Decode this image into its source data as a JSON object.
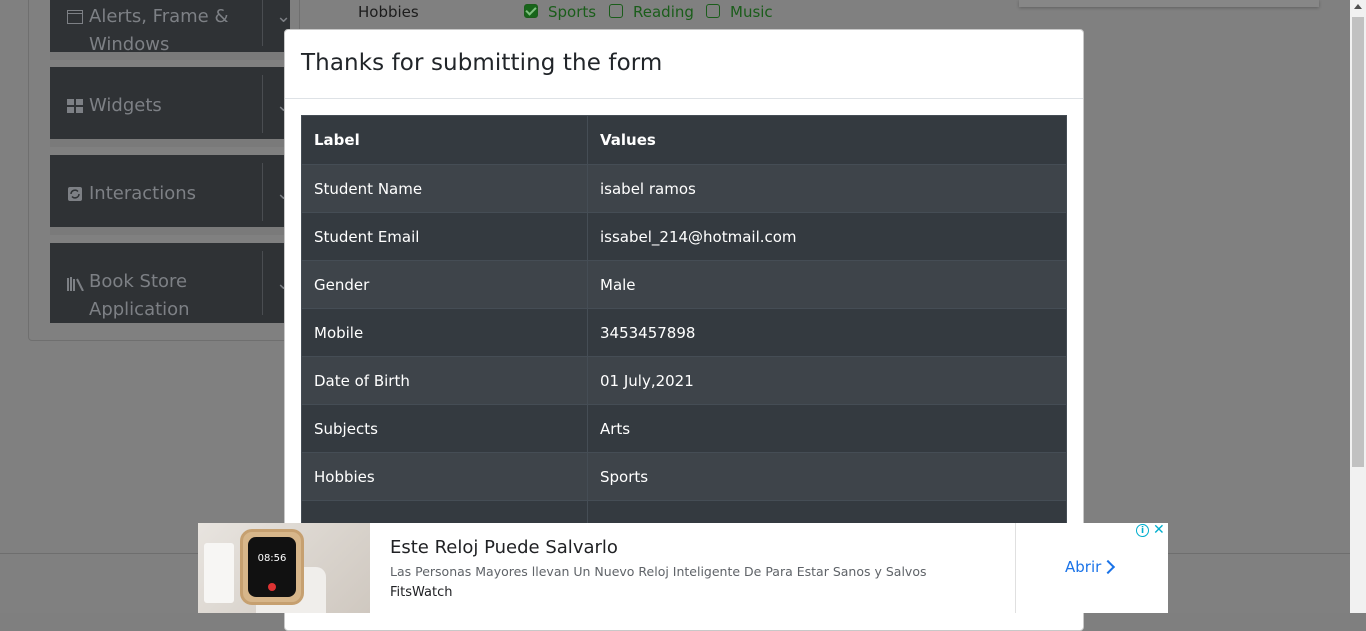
{
  "sidebar": {
    "groups": [
      {
        "label_line1": "Alerts, Frame &",
        "label_line2": "Windows",
        "icon": "window-icon"
      },
      {
        "label_line1": "Widgets",
        "icon": "widgets-icon"
      },
      {
        "label_line1": "Interactions",
        "icon": "interactions-icon"
      },
      {
        "label_line1": "Book Store",
        "label_line2": "Application",
        "icon": "book-icon"
      }
    ]
  },
  "form": {
    "hobbies_label": "Hobbies",
    "hobbies": [
      {
        "label": "Sports",
        "checked": true
      },
      {
        "label": "Reading",
        "checked": false
      },
      {
        "label": "Music",
        "checked": false
      }
    ]
  },
  "modal": {
    "title": "Thanks for submitting the form",
    "table": {
      "headers": [
        "Label",
        "Values"
      ],
      "rows": [
        [
          "Student Name",
          "isabel ramos"
        ],
        [
          "Student Email",
          "issabel_214@hotmail.com"
        ],
        [
          "Gender",
          "Male"
        ],
        [
          "Mobile",
          "3453457898"
        ],
        [
          "Date of Birth",
          "01 July,2021"
        ],
        [
          "Subjects",
          "Arts"
        ],
        [
          "Hobbies",
          "Sports"
        ],
        [
          "",
          ""
        ]
      ]
    }
  },
  "ad": {
    "title": "Este Reloj Puede Salvarlo",
    "description": "Las Personas Mayores llevan Un Nuevo Reloj Inteligente De Para Estar Sanos y Salvos",
    "brand": "FitsWatch",
    "cta": "Abrir",
    "watch_time": "08:56",
    "info_icon": "i",
    "close_icon": "✕"
  }
}
